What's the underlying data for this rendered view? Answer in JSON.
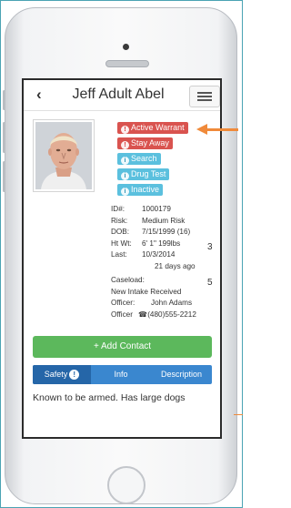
{
  "header": {
    "back_icon": "chevron-left-icon",
    "title": "Jeff Adult Abel",
    "menu_icon": "hamburger-icon"
  },
  "badges": [
    {
      "label": "Active Warrant",
      "icon": "warning-icon",
      "color": "#d9534f"
    },
    {
      "label": "Stay Away",
      "icon": "warning-icon",
      "color": "#d9534f"
    },
    {
      "label": "Search",
      "icon": "info-icon",
      "color": "#5bc0de"
    },
    {
      "label": "Drug Test",
      "icon": "info-icon",
      "color": "#5bc0de"
    },
    {
      "label": "Inactive",
      "icon": "info-icon",
      "color": "#5bc0de"
    }
  ],
  "details": {
    "id_label": "ID#:",
    "id_value": "1000179",
    "risk_label": "Risk:",
    "risk_value": "Medium Risk",
    "dob_label": "DOB:",
    "dob_value": "7/15/1999 (16)",
    "htwt_label": "Ht Wt:",
    "htwt_value": "6' 1\" 199lbs",
    "last_label": "Last:",
    "last_value": "10/3/2014",
    "last_ago": "21 days ago",
    "caseload_label": "Caseload:",
    "caseload_value": "New Intake Received",
    "officer_label": "Officer:",
    "officer_value": "John Adams",
    "officer_phone_label": "Officer",
    "officer_phone": "(480)555-2212",
    "edge_chars": [
      "3",
      "5"
    ]
  },
  "add_contact": {
    "label": "+ Add Contact"
  },
  "tabs": [
    {
      "label": "Safety",
      "badge": "!"
    },
    {
      "label": "Info"
    },
    {
      "label": "Description"
    }
  ],
  "note": "Known to be armed. Has large dogs",
  "colors": {
    "danger": "#d9534f",
    "info": "#5bc0de",
    "success": "#5cb85c",
    "primary": "#3a87cf",
    "annotation": "#f08a3a"
  }
}
